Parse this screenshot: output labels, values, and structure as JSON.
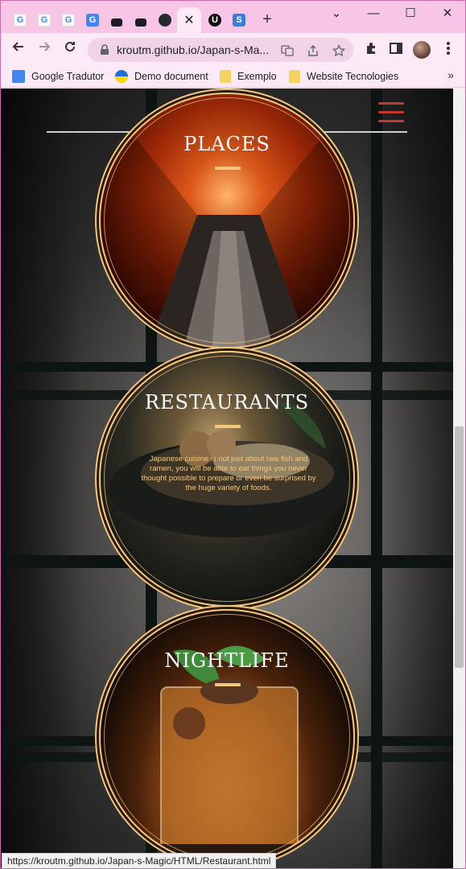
{
  "browser": {
    "tabs": [
      {
        "icon": "google-icon",
        "letter": "G",
        "color": "#4285f4"
      },
      {
        "icon": "google-icon",
        "letter": "G",
        "color": "#4285f4"
      },
      {
        "icon": "google-icon",
        "letter": "G",
        "color": "#4285f4"
      },
      {
        "icon": "google-translate-icon",
        "letter": "G",
        "color": "#4285f4"
      },
      {
        "icon": "udemy-icon",
        "letter": "",
        "color": "#1c1d1f"
      },
      {
        "icon": "udemy-icon",
        "letter": "",
        "color": "#1c1d1f"
      },
      {
        "icon": "github-icon",
        "letter": "",
        "color": "#24292e"
      },
      {
        "icon": "close-icon",
        "letter": "✕",
        "color": "#222222"
      },
      {
        "icon": "uwill-icon",
        "letter": "U",
        "color": "#111111"
      },
      {
        "icon": "sheets-icon",
        "letter": "S",
        "color": "#3a7bd5"
      }
    ],
    "new_tab": "+",
    "window_controls": {
      "dropdown": "⌄",
      "minimize": "—",
      "maximize": "☐",
      "close": "✕"
    },
    "url": "kroutm.github.io/Japan-s-Ma...",
    "bookmarks": [
      {
        "label": "Google Tradutor",
        "icon": "google-translate-icon",
        "color": "#4285f4"
      },
      {
        "label": "Demo document",
        "icon": "ukraine-icon",
        "color": "#ffd500"
      },
      {
        "label": "Exemplo",
        "icon": "folder-icon",
        "color": "#f4c430"
      },
      {
        "label": "Website Tecnologies",
        "icon": "folder-icon",
        "color": "#f4c430"
      }
    ],
    "bookmarks_more": "»",
    "status_url": "https://kroutm.github.io/Japan-s-Magic/HTML/Restaurant.html"
  },
  "page": {
    "accent": "#f5c77e",
    "menu_color": "#c0392b",
    "sections": [
      {
        "title": "PLACES",
        "description": ""
      },
      {
        "title": "RESTAURANTS",
        "description": "Japanese cuisine is not just about raw fish and ramen, you will be able to eat things you never thought possible to prepare or even be surprised by the huge variety of foods."
      },
      {
        "title": "NIGHTLIFE",
        "description": ""
      }
    ]
  }
}
